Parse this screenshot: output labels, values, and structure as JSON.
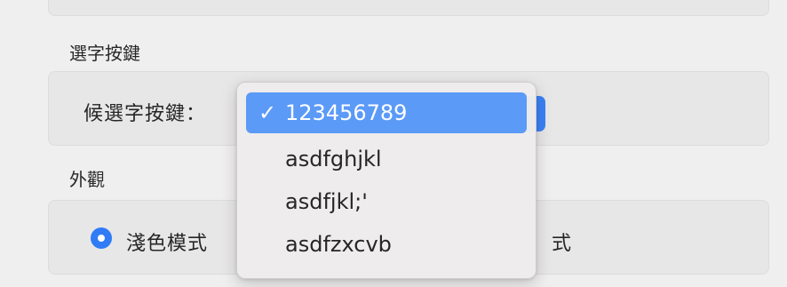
{
  "sections": {
    "selection_keys": {
      "title": "選字按鍵",
      "row_label": "候選字按鍵："
    },
    "appearance": {
      "title": "外觀",
      "light_mode_label": "淺色模式",
      "second_option_visible_label": "式"
    }
  },
  "popup_menu": {
    "items": [
      {
        "label": "123456789",
        "checked": true,
        "check_mark": "✓"
      },
      {
        "label": "asdfghjkl",
        "checked": false
      },
      {
        "label": "asdfjkl;'",
        "checked": false
      },
      {
        "label": "asdfzxcvb",
        "checked": false
      }
    ]
  },
  "colors": {
    "accent": "#2f7cf6",
    "menu_highlight": "#5b9af7",
    "panel": "#e8e7e7"
  }
}
